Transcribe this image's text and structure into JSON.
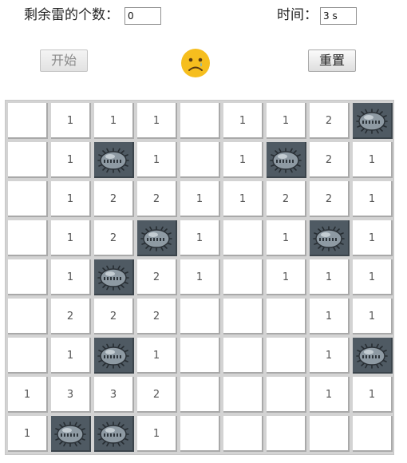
{
  "header": {
    "mines_label": "剩余雷的个数：",
    "mines_value": "0",
    "time_label": "时间：",
    "time_value": "3 s"
  },
  "controls": {
    "start_label": "开始",
    "start_enabled": false,
    "reset_label": "重置",
    "face_state": "sad-face-icon"
  },
  "board": {
    "rows": 9,
    "cols": 9,
    "cells": [
      [
        "",
        "1",
        "1",
        "1",
        "",
        "1",
        "1",
        "2",
        "*"
      ],
      [
        "",
        "1",
        "*",
        "1",
        "",
        "1",
        "*",
        "2",
        "1"
      ],
      [
        "",
        "1",
        "2",
        "2",
        "1",
        "1",
        "2",
        "2",
        "1"
      ],
      [
        "",
        "1",
        "2",
        "*",
        "1",
        "",
        "1",
        "*",
        "1"
      ],
      [
        "",
        "1",
        "*",
        "2",
        "1",
        "",
        "1",
        "1",
        "1"
      ],
      [
        "",
        "2",
        "2",
        "2",
        "",
        "",
        "",
        "1",
        "1"
      ],
      [
        "",
        "1",
        "*",
        "1",
        "",
        "",
        "",
        "1",
        "*"
      ],
      [
        "1",
        "3",
        "3",
        "2",
        "",
        "",
        "",
        "1",
        "1"
      ],
      [
        "1",
        "*",
        "*",
        "1",
        "",
        "",
        "",
        "",
        ""
      ]
    ]
  },
  "colors": {
    "mine_bg": "#4f5a63",
    "face": "#f6be1e"
  }
}
